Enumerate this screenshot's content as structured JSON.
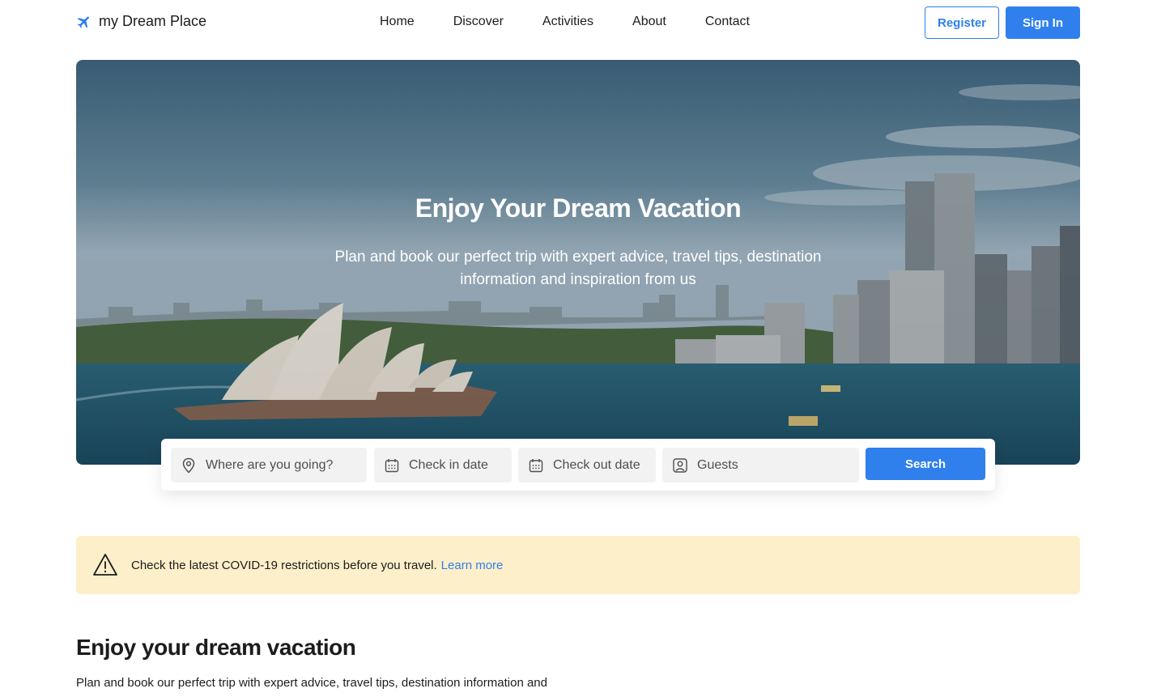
{
  "header": {
    "logo_text": "my Dream Place",
    "logo_icon": "airplane-icon",
    "nav": [
      "Home",
      "Discover",
      "Activities",
      "About",
      "Contact"
    ],
    "register_label": "Register",
    "signin_label": "Sign In"
  },
  "hero": {
    "title": "Enjoy Your Dream Vacation",
    "subtitle": "Plan and book our perfect trip with expert advice, travel tips, destination information and inspiration from us"
  },
  "search": {
    "where_placeholder": "Where are you going?",
    "checkin_placeholder": "Check in date",
    "checkout_placeholder": "Check out date",
    "guests_placeholder": "Guests",
    "button_label": "Search"
  },
  "alert": {
    "text": "Check the latest COVID-19 restrictions before you travel.",
    "link": "Learn more"
  },
  "section": {
    "title": "Enjoy your dream vacation",
    "text": "Plan and book our perfect trip with expert advice, travel tips, destination information and"
  },
  "colors": {
    "accent": "#2f80ed",
    "alert_bg": "#fdefc9"
  }
}
